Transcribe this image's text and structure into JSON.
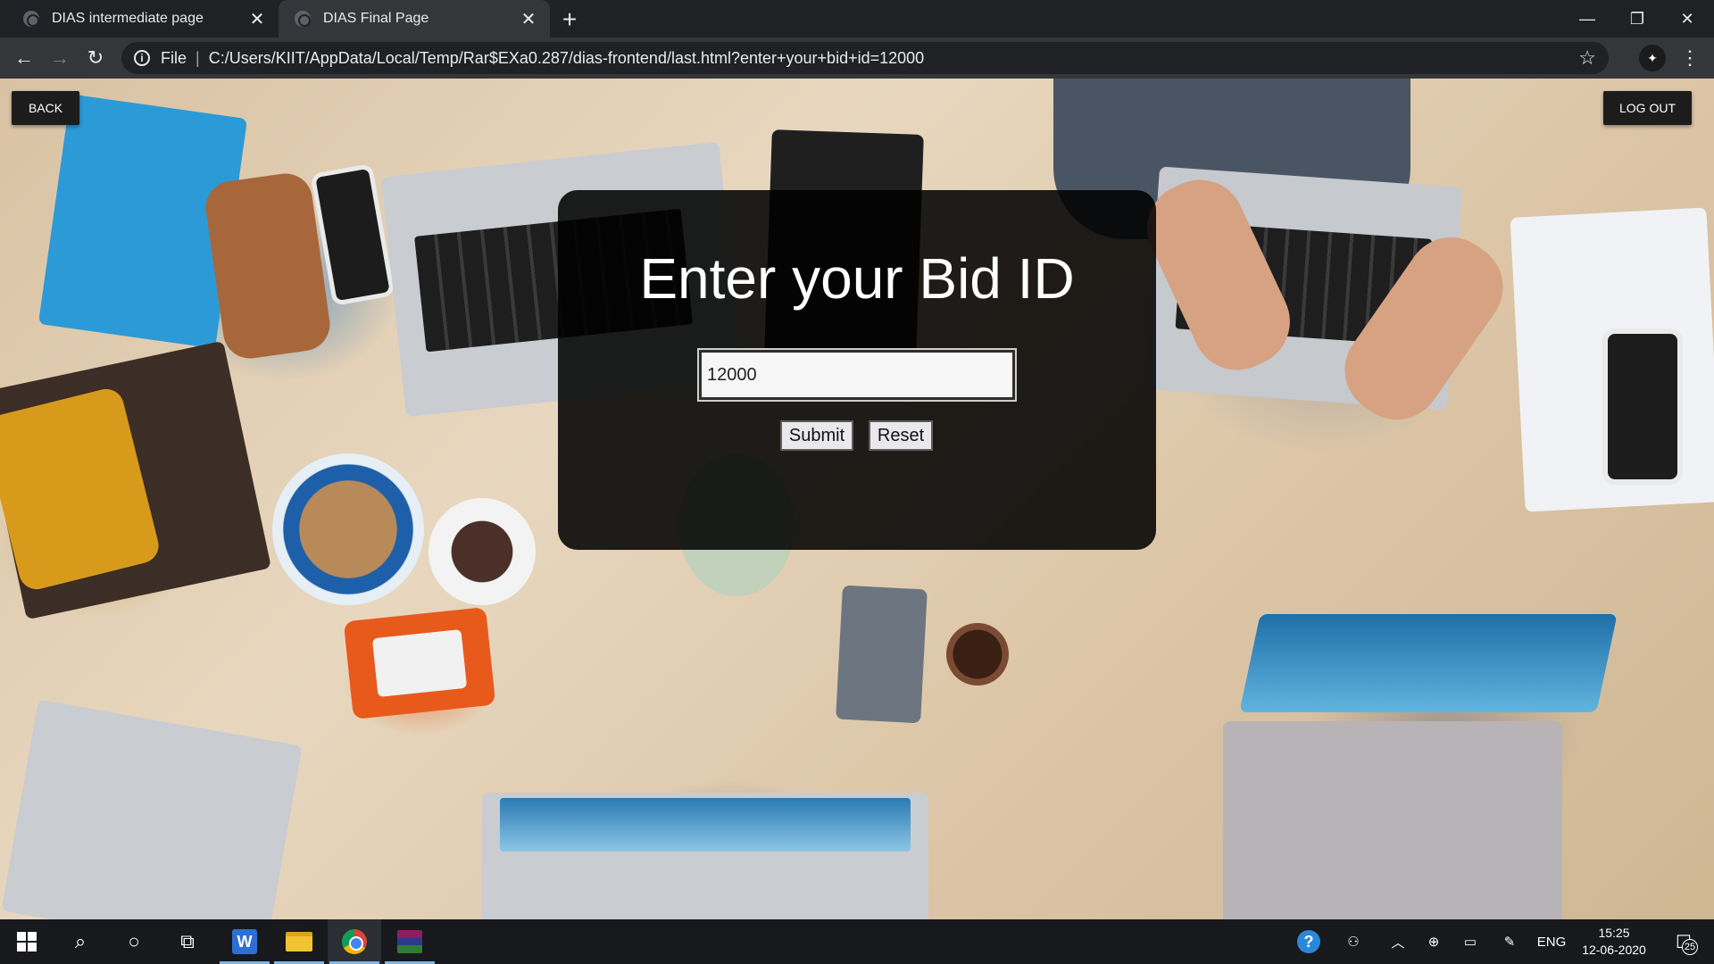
{
  "browser": {
    "tabs": [
      {
        "title": "DIAS intermediate page",
        "active": false
      },
      {
        "title": "DIAS Final Page",
        "active": true
      }
    ],
    "address": {
      "scheme_label": "File",
      "url": "C:/Users/KIIT/AppData/Local/Temp/Rar$EXa0.287/dias-frontend/last.html?enter+your+bid+id=12000"
    },
    "icons": {
      "back": "back-arrow-icon",
      "forward": "forward-arrow-icon",
      "reload": "reload-icon",
      "info": "info-icon",
      "star": "star-icon",
      "menu": "kebab-menu-icon"
    }
  },
  "page": {
    "back_label": "BACK",
    "logout_label": "LOG OUT",
    "heading": "Enter your Bid ID",
    "bid_input_value": "12000",
    "submit_label": "Submit",
    "reset_label": "Reset"
  },
  "taskbar": {
    "apps": [
      "start",
      "search",
      "cortana",
      "task-view",
      "word",
      "file-explorer",
      "chrome",
      "winrar"
    ],
    "language": "ENG",
    "time": "15:25",
    "date": "12-06-2020",
    "notification_count": "25"
  },
  "colors": {
    "panel_bg": "#000000",
    "taskbar_bg": "#17191d",
    "chrome_tab_active": "#35363a"
  }
}
